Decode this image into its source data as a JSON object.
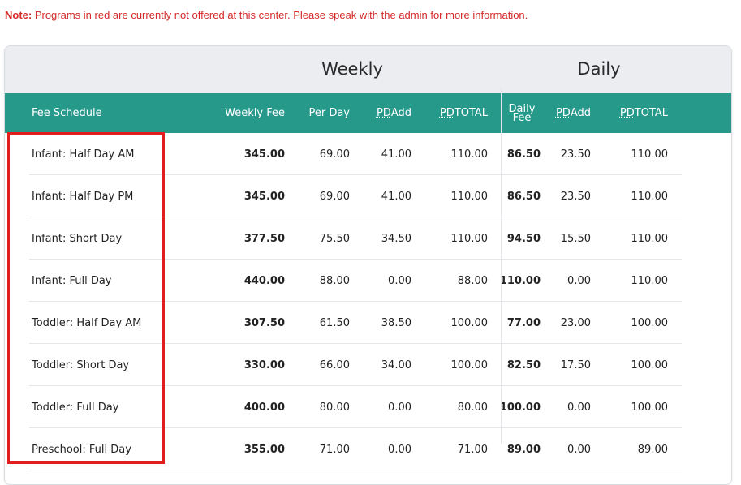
{
  "note": {
    "prefix": "Note:",
    "text": " Programs in red are currently not offered at this center. Please speak with the admin for more information."
  },
  "table": {
    "groups": {
      "weekly": "Weekly",
      "daily": "Daily"
    },
    "headers": {
      "fee_schedule": "Fee Schedule",
      "weekly_fee": "Weekly Fee",
      "per_day": "Per Day",
      "pd_add_pd": "PD",
      "pd_add_rest": " Add",
      "pd_total_pd": "PD",
      "pd_total_rest": " TOTAL",
      "daily_fee_1": "Daily",
      "daily_fee_2": "Fee",
      "d_pd_add_pd": "PD",
      "d_pd_add_rest": " Add",
      "d_pd_total_pd": "PD",
      "d_pd_total_rest": " TOTAL"
    },
    "rows": [
      {
        "name": "Infant: Half Day AM",
        "weekly_fee": "345.00",
        "per_day": "69.00",
        "pd_add": "41.00",
        "pd_total": "110.00",
        "daily_fee": "86.50",
        "d_pd_add": "23.50",
        "d_pd_total": "110.00"
      },
      {
        "name": "Infant: Half Day PM",
        "weekly_fee": "345.00",
        "per_day": "69.00",
        "pd_add": "41.00",
        "pd_total": "110.00",
        "daily_fee": "86.50",
        "d_pd_add": "23.50",
        "d_pd_total": "110.00"
      },
      {
        "name": "Infant: Short Day",
        "weekly_fee": "377.50",
        "per_day": "75.50",
        "pd_add": "34.50",
        "pd_total": "110.00",
        "daily_fee": "94.50",
        "d_pd_add": "15.50",
        "d_pd_total": "110.00"
      },
      {
        "name": "Infant: Full Day",
        "weekly_fee": "440.00",
        "per_day": "88.00",
        "pd_add": "0.00",
        "pd_total": "88.00",
        "daily_fee": "110.00",
        "d_pd_add": "0.00",
        "d_pd_total": "110.00"
      },
      {
        "name": "Toddler: Half Day AM",
        "weekly_fee": "307.50",
        "per_day": "61.50",
        "pd_add": "38.50",
        "pd_total": "100.00",
        "daily_fee": "77.00",
        "d_pd_add": "23.00",
        "d_pd_total": "100.00"
      },
      {
        "name": "Toddler: Short Day",
        "weekly_fee": "330.00",
        "per_day": "66.00",
        "pd_add": "34.00",
        "pd_total": "100.00",
        "daily_fee": "82.50",
        "d_pd_add": "17.50",
        "d_pd_total": "100.00"
      },
      {
        "name": "Toddler: Full Day",
        "weekly_fee": "400.00",
        "per_day": "80.00",
        "pd_add": "0.00",
        "pd_total": "80.00",
        "daily_fee": "100.00",
        "d_pd_add": "0.00",
        "d_pd_total": "100.00"
      },
      {
        "name": "Preschool: Full Day",
        "weekly_fee": "355.00",
        "per_day": "71.00",
        "pd_add": "0.00",
        "pd_total": "71.00",
        "daily_fee": "89.00",
        "d_pd_add": "0.00",
        "d_pd_total": "89.00"
      }
    ]
  },
  "colors": {
    "note_red": "#d42a2a",
    "header_teal": "#27998a",
    "group_bg": "#ebedf1",
    "highlight_red": "#e21d1d"
  }
}
